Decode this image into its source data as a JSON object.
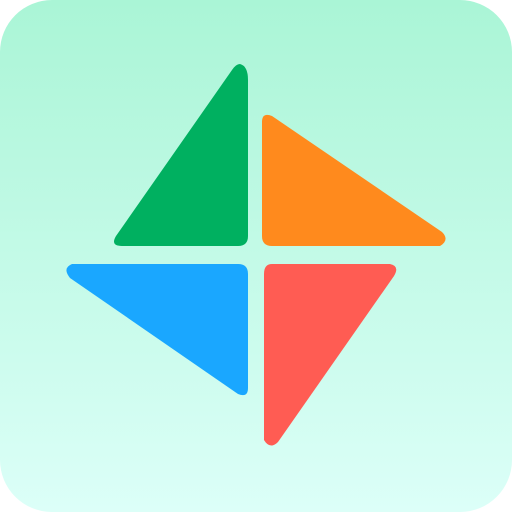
{
  "icon": {
    "name": "pinwheel-app-icon",
    "colors": {
      "background_top": "#aaf5d6",
      "background_bottom": "#dcfff8",
      "green": "#00b060",
      "orange": "#ff8a1d",
      "blue": "#1aa7ff",
      "red": "#ff5c53"
    }
  }
}
